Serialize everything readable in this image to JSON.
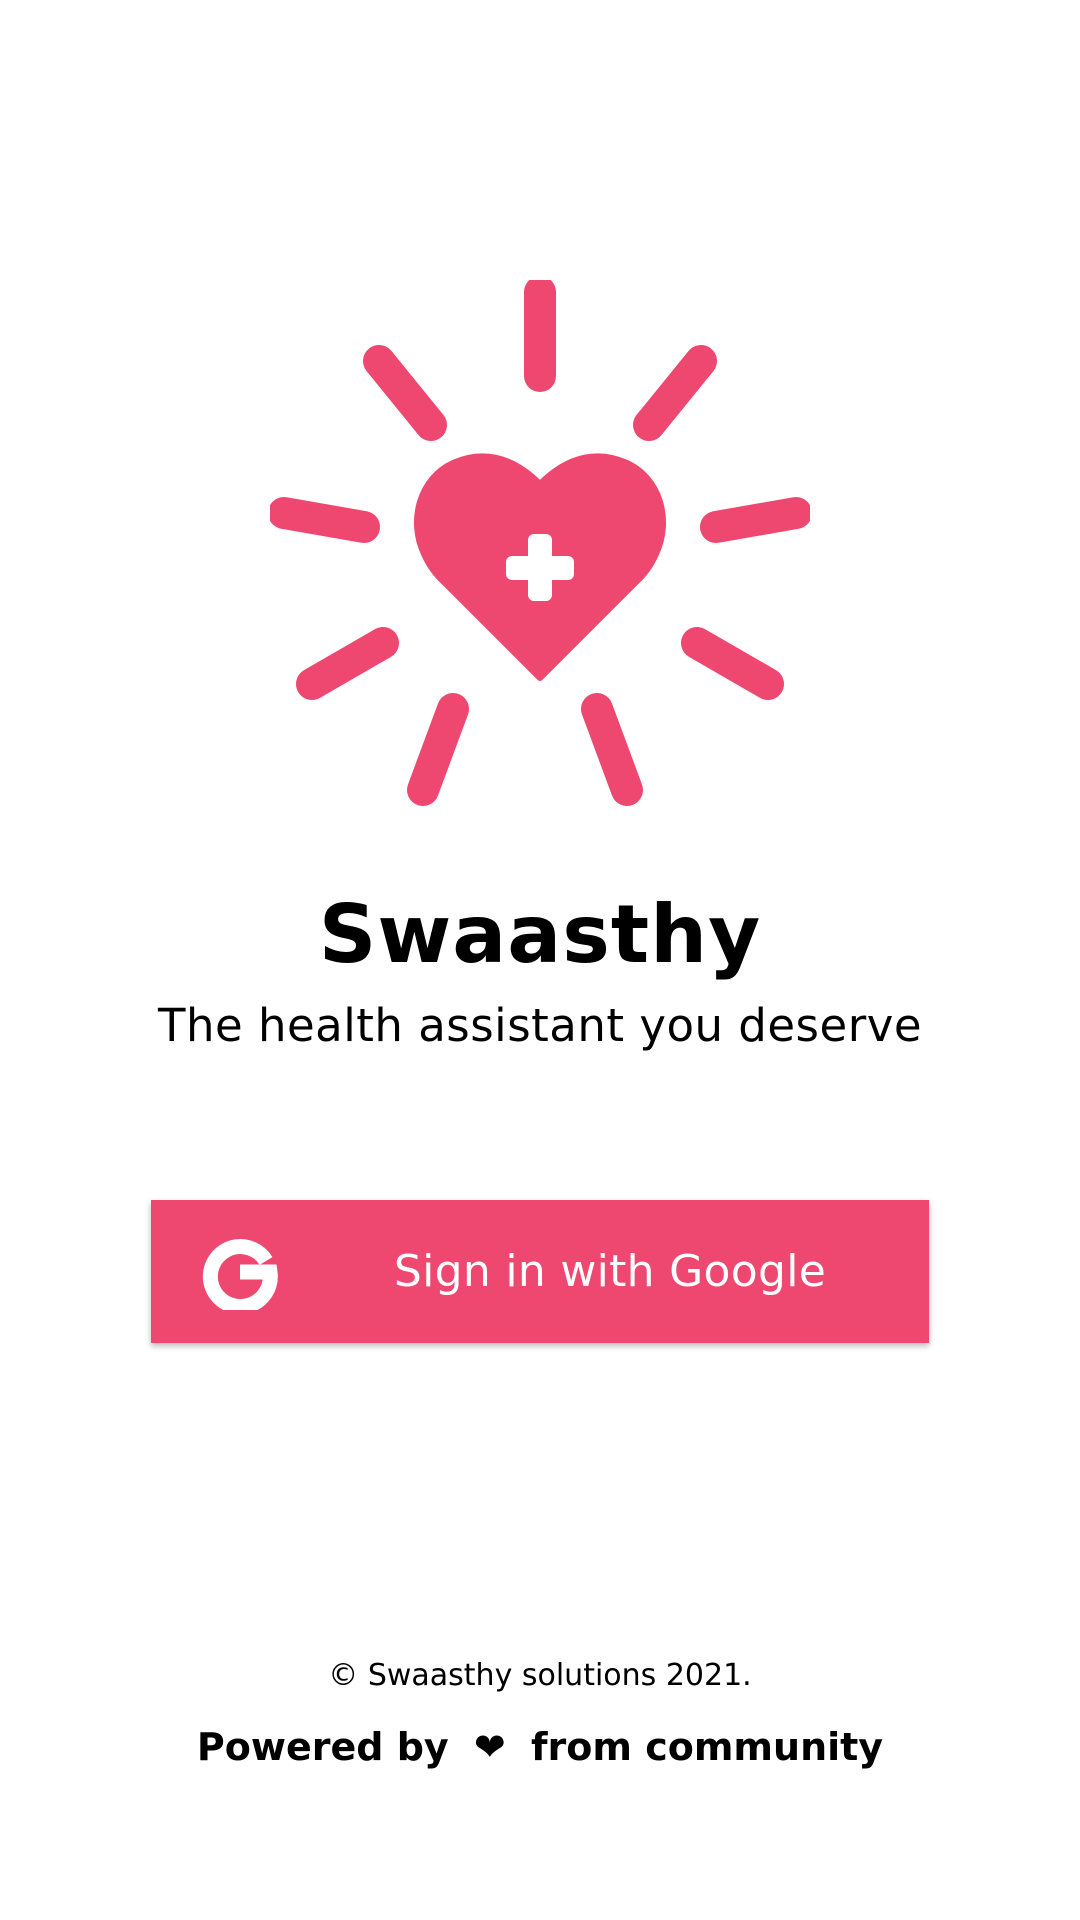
{
  "app": {
    "title": "Swaasthy",
    "tagline": "The health assistant you deserve"
  },
  "logo": {
    "icon": "heart-with-medical-cross-and-rays-icon",
    "color": "#ef4870"
  },
  "sign_in": {
    "label": "Sign in with Google",
    "icon": "google-g-icon",
    "background": "#ef4870"
  },
  "footer": {
    "copyright": "© Swaasthy solutions 2021.",
    "powered_prefix": "Powered by",
    "powered_symbol": "❤",
    "powered_suffix": "from community"
  }
}
